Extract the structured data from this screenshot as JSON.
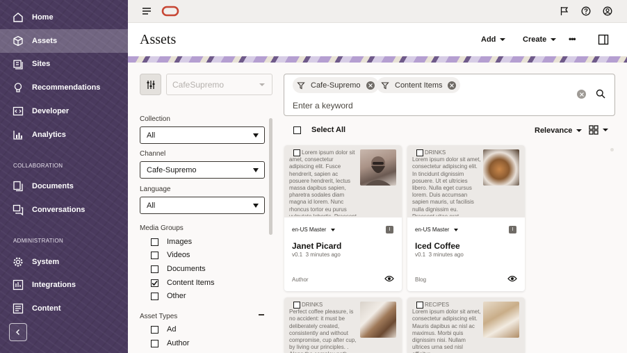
{
  "nav": {
    "items": [
      {
        "label": "Home",
        "icon": "home-icon"
      },
      {
        "label": "Assets",
        "icon": "cube-icon"
      },
      {
        "label": "Sites",
        "icon": "sites-icon"
      },
      {
        "label": "Recommendations",
        "icon": "lightbulb-icon"
      },
      {
        "label": "Developer",
        "icon": "code-icon"
      },
      {
        "label": "Analytics",
        "icon": "bar-chart-icon"
      },
      {
        "label": "Documents",
        "icon": "document-icon"
      },
      {
        "label": "Conversations",
        "icon": "conversation-icon"
      },
      {
        "label": "System",
        "icon": "gear-icon"
      },
      {
        "label": "Integrations",
        "icon": "integrations-icon"
      },
      {
        "label": "Content",
        "icon": "content-icon"
      }
    ],
    "section_collaboration": "COLLABORATION",
    "section_administration": "ADMINISTRATION"
  },
  "header": {
    "title": "Assets",
    "add_label": "Add",
    "create_label": "Create",
    "more_label": "•••"
  },
  "filters": {
    "repository": "CafeSupremo",
    "collection_label": "Collection",
    "collection_value": "All",
    "channel_label": "Channel",
    "channel_value": "Cafe-Supremo",
    "language_label": "Language",
    "language_value": "All",
    "media_groups_label": "Media Groups",
    "media_groups": [
      {
        "label": "Images",
        "checked": false
      },
      {
        "label": "Videos",
        "checked": false
      },
      {
        "label": "Documents",
        "checked": false
      },
      {
        "label": "Content Items",
        "checked": true
      },
      {
        "label": "Other",
        "checked": false
      }
    ],
    "asset_types_label": "Asset Types",
    "asset_types": [
      {
        "label": "Ad",
        "checked": false
      },
      {
        "label": "Author",
        "checked": false
      }
    ]
  },
  "search": {
    "chips": [
      "Cafe-Supremo",
      "Content Items"
    ],
    "placeholder": "Enter a keyword"
  },
  "results": {
    "select_all": "Select All",
    "sort_label": "Relevance"
  },
  "cards": [
    {
      "type_label": "",
      "excerpt": "Lorem ipsum dolor sit amet, consectetur adipiscing elit. Fusce hendrerit, sapien ac posuere hendrerit, lectus massa dapibus sapien, pharetra sodales diam magna id lorem. Nunc rhoncus tortor eu purus vulputate lobortis. Praesent eget leo non enim",
      "language": "en-US Master",
      "name": "Janet Picard",
      "version": "v0.1",
      "time": "3 minutes ago",
      "content_type": "Author",
      "badge": "I"
    },
    {
      "type_label": "DRINKS",
      "excerpt": "Lorem ipsum dolor sit amet, consectetur adipiscing elit. In tincidunt dignissim posuere. Ut et ultricies libero. Nulla eget cursus lorem. Duis accumsan sapien mauris, ut facilisis nulla dignissim eu. Praesent vitae erat imperdiet ante accumsan finibus.",
      "language": "en-US Master",
      "name": "Iced Coffee",
      "version": "v0.1",
      "time": "3 minutes ago",
      "content_type": "Blog",
      "badge": "I"
    },
    {
      "type_label": "DRINKS",
      "excerpt": "Perfect coffee pleasure, is no accident: it must be deliberately created, consistently and without compromise, cup after cup, by living our principles. . Along the complex path from",
      "language": "",
      "name": "",
      "version": "",
      "time": "",
      "content_type": "",
      "badge": ""
    },
    {
      "type_label": "RECIPES",
      "excerpt": "Lorem ipsum dolor sit amet, consectetur adipiscing elit. Mauris dapibus ac nisl ac maximus. Morbi quis dignissim nisi. Nullam ultrices urna sed nisl efficitur",
      "language": "",
      "name": "",
      "version": "",
      "time": "",
      "content_type": "",
      "badge": ""
    }
  ]
}
